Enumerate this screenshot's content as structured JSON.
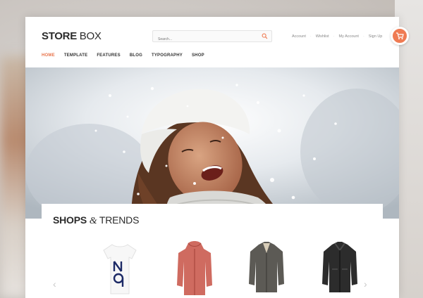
{
  "header": {
    "logo_strong": "STORE",
    "logo_light": "BOX",
    "search_placeholder": "Search...",
    "account_links": [
      "Account",
      "Wishlist",
      "My Account",
      "Sign Up"
    ]
  },
  "nav": {
    "items": [
      "HOME",
      "TEMPLATE",
      "FEATURES",
      "BLOG",
      "TYPOGRAPHY",
      "SHOP"
    ],
    "active": "HOME"
  },
  "section": {
    "title_strong": "SHOPS",
    "title_amp": "&",
    "title_light": "TRENDS"
  },
  "colors": {
    "accent": "#ef7b53",
    "text": "#2b2b2b"
  },
  "icons": [
    "search-icon",
    "cart-icon",
    "chevron-left-icon",
    "chevron-right-icon"
  ]
}
